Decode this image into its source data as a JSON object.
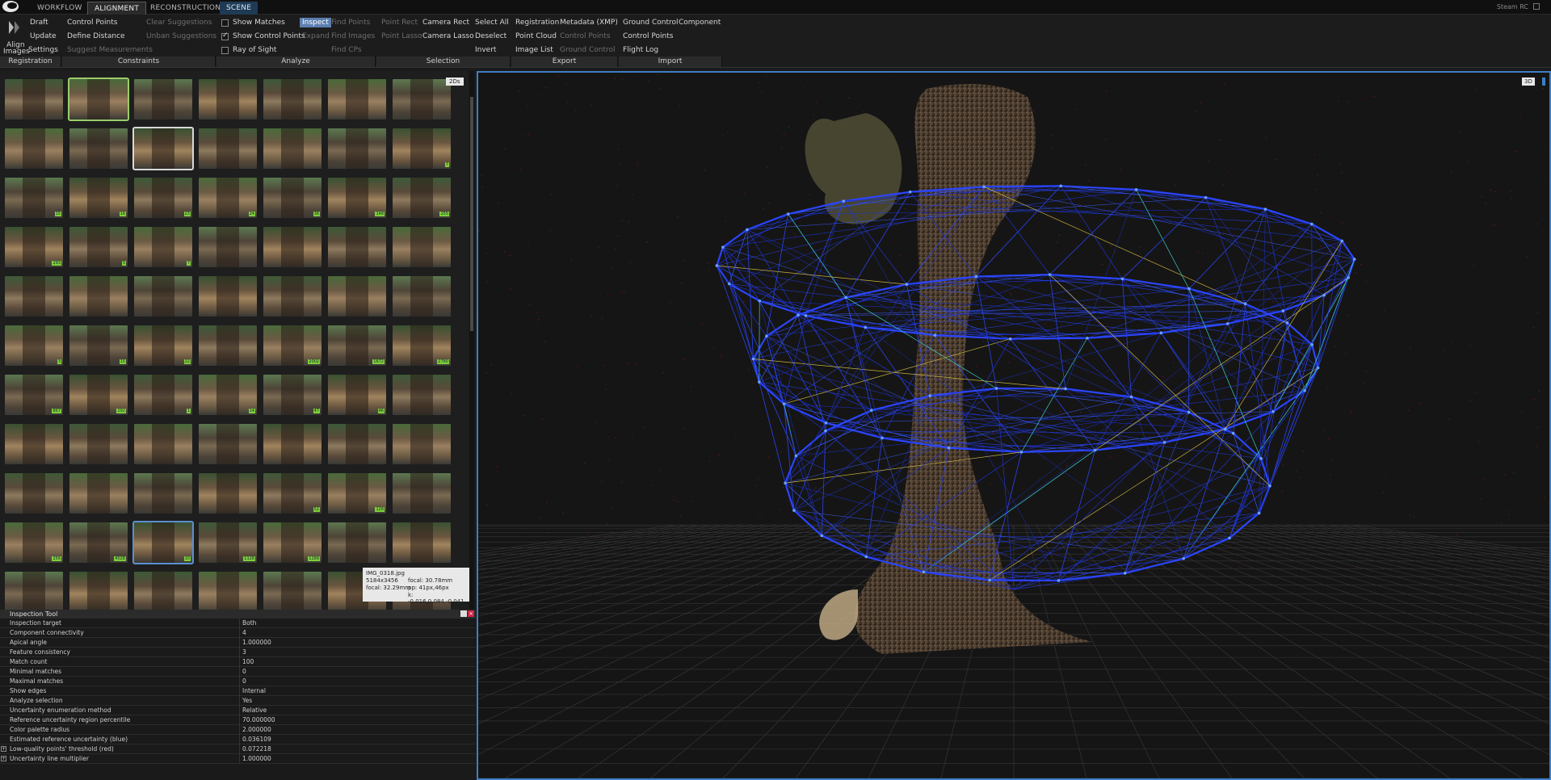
{
  "tabs": {
    "workflow": "WORKFLOW",
    "alignment": "ALIGNMENT",
    "reconstruction": "RECONSTRUCTION",
    "scene": "SCENE"
  },
  "app_label": "Steam RC",
  "ribbon": {
    "align_images_line1": "Align",
    "align_images_line2": "Images",
    "draft": "Draft",
    "update": "Update",
    "settings": "Settings",
    "control_points": "Control Points",
    "define_distance": "Define Distance",
    "suggest_measurements": "Suggest Measurements",
    "clear_suggestions": "Clear Suggestions",
    "unban_suggestions": "Unban Suggestions",
    "show_matches": "Show Matches",
    "show_control_points": "Show Control Points",
    "ray_of_sight": "Ray of Sight",
    "inspect": "Inspect",
    "expand": "Expand",
    "find_points": "Find Points",
    "find_images": "Find Images",
    "find_cps": "Find CPs",
    "point_rect": "Point Rect",
    "point_lasso": "Point Lasso",
    "camera_rect": "Camera Rect",
    "camera_lasso": "Camera Lasso",
    "select_all": "Select All",
    "deselect": "Deselect",
    "invert": "Invert",
    "registration": "Registration",
    "point_cloud": "Point Cloud",
    "image_list": "Image List",
    "metadata_xmp": "Metadata (XMP)",
    "export_control_points": "Control Points",
    "export_ground_control": "Ground Control",
    "import_ground_control": "Ground Control",
    "component": "Component",
    "import_control_points": "Control Points",
    "flight_log": "Flight Log",
    "checks": {
      "show_matches": false,
      "show_control_points": true,
      "ray_of_sight": false
    },
    "groups": {
      "registration": "Registration",
      "constraints": "Constraints",
      "analyze": "Analyze",
      "selection": "Selection",
      "export": "Export",
      "import": "Import"
    }
  },
  "view_tags": {
    "left": "2Ds",
    "right": "3D"
  },
  "tooltip": {
    "filename": "IMG_0318.jpg",
    "size": "5184x3456",
    "focal": "focal: 32.29mm",
    "focal2": "focal: 30.78mm",
    "pp": "pp: 41px,46px",
    "k": "k: -0.016,0.084,-0.041"
  },
  "inspection": {
    "title": "Inspection Tool",
    "rows": [
      {
        "key": "Inspection target",
        "value": "Both"
      },
      {
        "key": "Component connectivity",
        "value": "4"
      },
      {
        "key": "Apical angle",
        "value": "1.000000"
      },
      {
        "key": "Feature consistency",
        "value": "3"
      },
      {
        "key": "Match count",
        "value": "100"
      },
      {
        "key": "Minimal matches",
        "value": "0"
      },
      {
        "key": "Maximal matches",
        "value": "0"
      },
      {
        "key": "Show edges",
        "value": "Internal"
      },
      {
        "key": "Analyze selection",
        "value": "Yes"
      },
      {
        "key": "Uncertainty enumeration method",
        "value": "Relative"
      },
      {
        "key": "Reference uncertainty region percentile",
        "value": "70.000000"
      },
      {
        "key": "Color palette radius",
        "value": "2.000000"
      },
      {
        "key": "Estimated reference uncertainty (blue)",
        "value": "0.036109"
      },
      {
        "key": "Low-quality points' threshold (red)",
        "value": "0.072218"
      },
      {
        "key": "Uncertainty line multiplier",
        "value": "1.000000"
      }
    ]
  },
  "thumbnails": {
    "badges": [
      "",
      "",
      "",
      "",
      "",
      "",
      "",
      "",
      "",
      "",
      "",
      "",
      "",
      "7",
      "15",
      "16",
      "23",
      "24",
      "36",
      "148",
      "255",
      "293",
      "5",
      "7",
      "",
      "",
      "",
      "",
      "",
      "",
      "",
      "",
      "",
      "",
      "",
      "3",
      "15",
      "22",
      "",
      "2002",
      "1672",
      "2780",
      "867",
      "292",
      "1",
      "14",
      "47",
      "46",
      "",
      "",
      "",
      "",
      "",
      "",
      "",
      "",
      "",
      "",
      "",
      "",
      "52",
      "128",
      "",
      "256",
      "4028",
      "10",
      "1128",
      "1289",
      "",
      ""
    ]
  },
  "colors": {
    "accent_blue": "#3d7ec4",
    "badge_green": "#7fcf3a",
    "selection_green": "#9acd6a"
  }
}
